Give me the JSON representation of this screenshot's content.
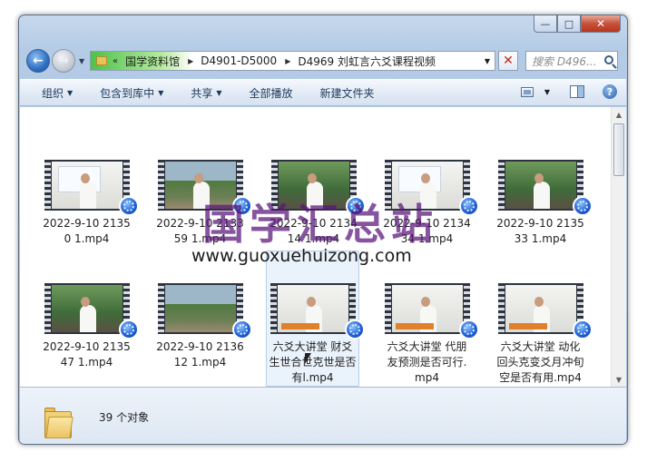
{
  "window": {
    "minimize": "—",
    "maximize": "□",
    "close": "✕"
  },
  "address": {
    "chevron": "«",
    "segments": [
      "国学资料馆",
      "D4901-D5000",
      "D4969 刘虹言六爻课程视频"
    ],
    "progress_fraction": 0.25
  },
  "search": {
    "placeholder": "搜索 D496..."
  },
  "toolbar": {
    "organize": "组织",
    "include_in_library": "包含到库中",
    "share": "共享",
    "play_all": "全部播放",
    "new_folder": "新建文件夹"
  },
  "files": [
    {
      "name": "2022-9-10 21350 1.mp4",
      "scene": "white"
    },
    {
      "name": "2022-9-10 213359 1.mp4",
      "scene": "trees"
    },
    {
      "name": "2022-9-10 213414 1.mp4",
      "scene": "green"
    },
    {
      "name": "2022-9-10 213434 1.mp4",
      "scene": "white"
    },
    {
      "name": "2022-9-10 213533 1.mp4",
      "scene": "green"
    },
    {
      "name": "2022-9-10 213547 1.mp4",
      "scene": "green"
    },
    {
      "name": "2022-9-10 213612 1.mp4",
      "scene": "trees"
    },
    {
      "name": "六爻大讲堂 财爻生世合世克世是否有l.mp4",
      "scene": "white"
    },
    {
      "name": "六爻大讲堂 代朋友预测是否可行.mp4",
      "scene": "white"
    },
    {
      "name": "六爻大讲堂 动化回头克变爻月冲旬空是否有用.mp4",
      "scene": "white"
    }
  ],
  "watermark": {
    "text": "国学汇总站",
    "url": "www.guoxuehuizong.com"
  },
  "details": {
    "count": "39 个对象"
  },
  "icons": {
    "back": "arrow-left-icon",
    "forward": "arrow-right-icon",
    "search": "search-icon",
    "help": "help-icon",
    "folder": "folder-icon",
    "media": "media-player-icon"
  }
}
